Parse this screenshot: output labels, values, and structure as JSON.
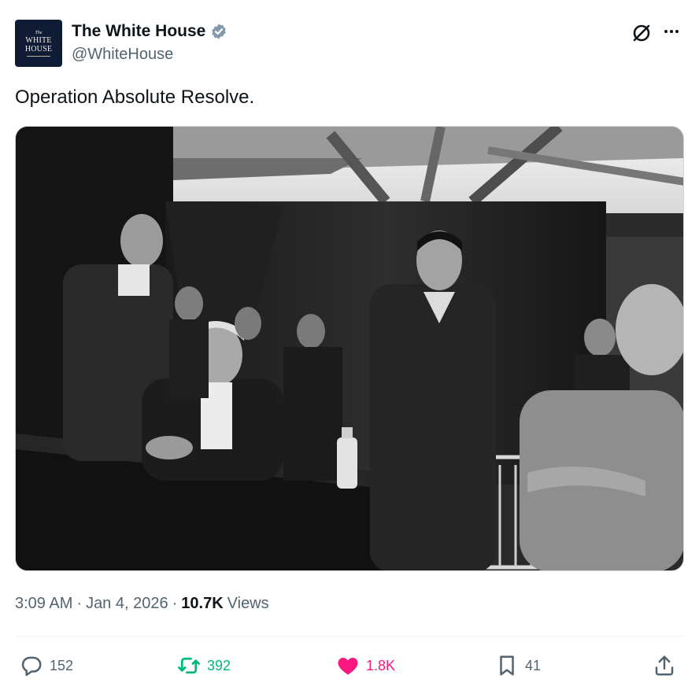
{
  "author": {
    "display_name": "The White House",
    "handle": "@WhiteHouse",
    "verified": true,
    "avatar_text": {
      "line_small": "The",
      "line1": "WHITE",
      "line2": "HOUSE"
    }
  },
  "icons": {
    "verified": "verified-badge-icon",
    "grok": "grok-icon",
    "more": "more-icon",
    "reply": "reply-icon",
    "retweet": "retweet-icon",
    "like": "heart-icon",
    "bookmark": "bookmark-icon",
    "share": "share-icon"
  },
  "tweet": {
    "text": "Operation Absolute Resolve.",
    "time": "3:09 AM",
    "date": "Jan 4, 2026",
    "views_count": "10.7K",
    "views_label": "Views"
  },
  "stats": {
    "replies": "152",
    "retweets": "392",
    "likes": "1.8K",
    "bookmarks": "41"
  },
  "colors": {
    "text": "#0f1419",
    "secondary": "#536471",
    "verified": "#829aab",
    "retweet": "#00ba7c",
    "like": "#f91880",
    "avatar_bg": "#101c36"
  }
}
